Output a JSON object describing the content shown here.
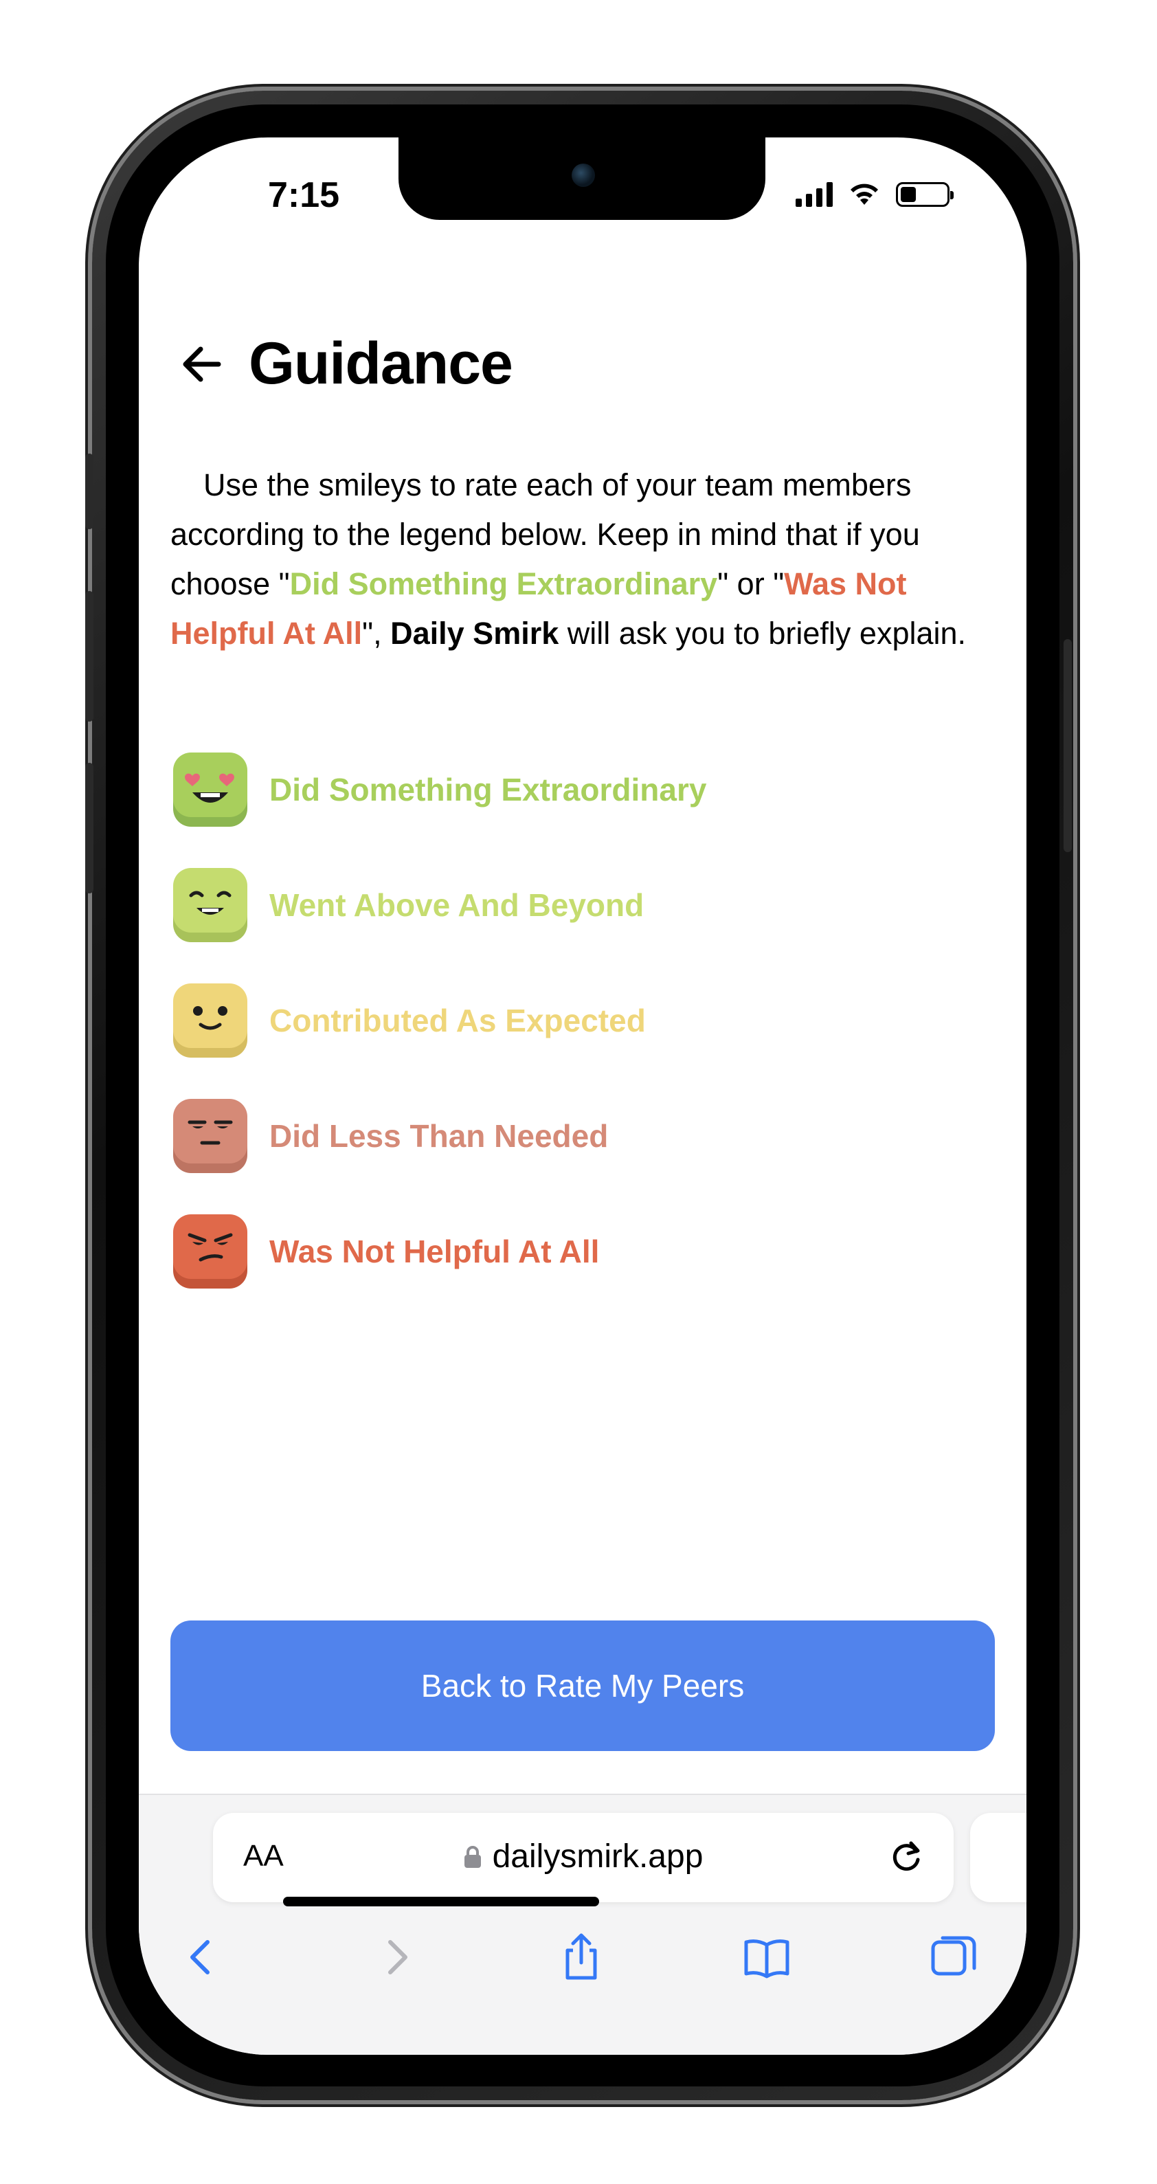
{
  "status_bar": {
    "time": "7:15"
  },
  "header": {
    "title": "Guidance"
  },
  "intro": {
    "before": "Use the smileys to rate each of your team members according to the legend below. Keep in mind that if you choose \"",
    "highlight_positive": "Did Something Extraordinary",
    "middle": "\" or \"",
    "highlight_negative": "Was Not Helpful At All",
    "after_quote": "\", ",
    "app_name": "Daily Smirk",
    "end": " will ask you to briefly explain."
  },
  "legend": [
    {
      "label": "Did Something Extraordinary",
      "color": "#a8cf5c",
      "icon": "heart-eyes-smiley-icon"
    },
    {
      "label": "Went Above And Beyond",
      "color": "#c5dc6f",
      "icon": "happy-smiley-icon"
    },
    {
      "label": "Contributed As Expected",
      "color": "#efd67a",
      "icon": "neutral-smiley-icon"
    },
    {
      "label": "Did Less Than Needed",
      "color": "#d58a77",
      "icon": "unimpressed-smiley-icon"
    },
    {
      "label": "Was Not Helpful At All",
      "color": "#e0694a",
      "icon": "angry-smiley-icon"
    }
  ],
  "cta": {
    "label": "Back to Rate My Peers",
    "color": "#5183ec"
  },
  "browser": {
    "text_size_label": "AA",
    "url": "dailysmirk.app"
  }
}
